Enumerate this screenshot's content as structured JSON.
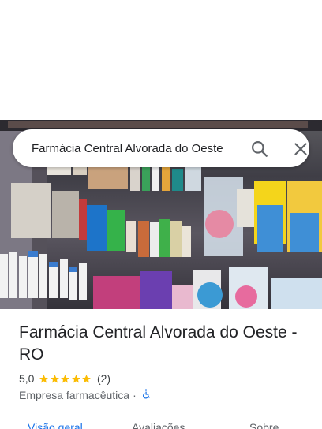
{
  "search": {
    "query": "Farmácia Central Alvorada do Oeste"
  },
  "icons": {
    "search": "search-icon",
    "close": "close-icon",
    "star": "star-icon",
    "accessibility": "wheelchair-icon"
  },
  "place": {
    "name": "Farmácia Central Alvorada do Oeste - RO",
    "rating": "5,0",
    "stars": 5,
    "review_count": "(2)",
    "category": "Empresa farmacêutica",
    "separator": "·"
  },
  "tabs": [
    {
      "label": "Visão geral",
      "active": true
    },
    {
      "label": "Avaliações",
      "active": false
    },
    {
      "label": "Sobre",
      "active": false
    }
  ],
  "colors": {
    "accent": "#1a73e8",
    "star": "#fbbc04",
    "text_primary": "#202124",
    "text_secondary": "#5f6368"
  }
}
